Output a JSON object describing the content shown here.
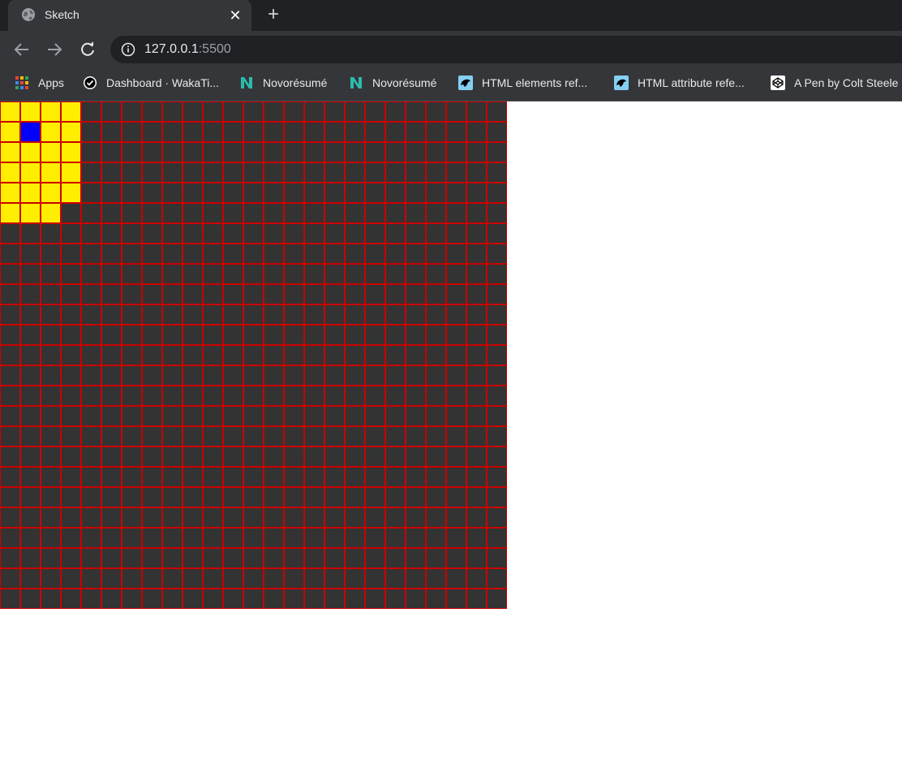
{
  "tab": {
    "title": "Sketch",
    "favicon": "globe-icon",
    "close_glyph": "✕",
    "new_tab_glyph": "+"
  },
  "toolbar": {
    "back_icon": "arrow-left-icon",
    "forward_icon": "arrow-right-icon",
    "reload_icon": "reload-icon",
    "info_icon": "info-icon",
    "url_host": "127.0.0.1",
    "url_port": ":5500"
  },
  "bookmarks": [
    {
      "label": "Apps",
      "icon": "apps-grid-icon"
    },
    {
      "label": "Dashboard · WakaTi...",
      "icon": "wakatime-icon"
    },
    {
      "label": "Novorésumé",
      "icon": "novoresume-icon"
    },
    {
      "label": "Novorésumé",
      "icon": "novoresume-icon"
    },
    {
      "label": "HTML elements ref...",
      "icon": "mdn-icon"
    },
    {
      "label": "HTML attribute refe...",
      "icon": "mdn-icon"
    },
    {
      "label": "A Pen by Colt Steele",
      "icon": "codepen-icon"
    }
  ],
  "sketch": {
    "columns": 25,
    "rows": 25,
    "cell_color": "#333333",
    "border_color": "#cc0000",
    "painted_color": "#ffee00",
    "cursor_color": "#0000ff",
    "painted_cells": [
      [
        0,
        0
      ],
      [
        0,
        1
      ],
      [
        0,
        2
      ],
      [
        0,
        3
      ],
      [
        1,
        0
      ],
      [
        1,
        1
      ],
      [
        1,
        2
      ],
      [
        1,
        3
      ],
      [
        2,
        0
      ],
      [
        2,
        1
      ],
      [
        2,
        2
      ],
      [
        2,
        3
      ],
      [
        3,
        0
      ],
      [
        3,
        1
      ],
      [
        3,
        2
      ],
      [
        3,
        3
      ],
      [
        4,
        0
      ],
      [
        4,
        1
      ],
      [
        4,
        2
      ],
      [
        4,
        3
      ],
      [
        5,
        0
      ],
      [
        5,
        1
      ],
      [
        5,
        2
      ]
    ],
    "cursor_cell": [
      1,
      1
    ]
  }
}
